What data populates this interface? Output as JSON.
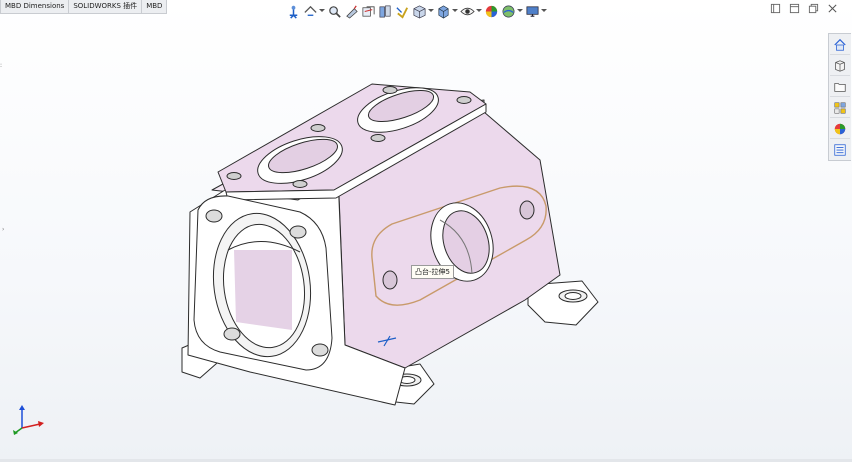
{
  "tabs": [
    {
      "label": "MBD Dimensions"
    },
    {
      "label": "SOLIDWORKS 插件"
    },
    {
      "label": "MBD"
    }
  ],
  "heads_up_toolbar": [
    {
      "icon": "zoom-to-fit-icon",
      "dropdown": false
    },
    {
      "icon": "zoom-to-area-icon",
      "dropdown": true
    },
    {
      "icon": "previous-view-icon",
      "dropdown": false
    },
    {
      "icon": "section-view-icon",
      "dropdown": false
    },
    {
      "icon": "dynamic-annotation-views-icon",
      "dropdown": false
    },
    {
      "icon": "view-orientation-icon",
      "dropdown": true
    },
    {
      "icon": "display-style-icon",
      "dropdown": true
    },
    {
      "icon": "hide-show-items-icon",
      "dropdown": true
    },
    {
      "icon": "edit-appearance-icon",
      "dropdown": false
    },
    {
      "icon": "apply-scene-icon",
      "dropdown": true
    },
    {
      "icon": "view-settings-icon",
      "dropdown": true
    }
  ],
  "window_controls": [
    "tile-icon",
    "restore-icon",
    "minimize-icon",
    "close-icon"
  ],
  "task_pane": [
    {
      "icon": "home-icon"
    },
    {
      "icon": "design-library-icon"
    },
    {
      "icon": "file-explorer-icon"
    },
    {
      "icon": "view-palette-icon"
    },
    {
      "icon": "appearances-icon"
    },
    {
      "icon": "custom-properties-icon"
    }
  ],
  "tooltip": {
    "label": "凸台-拉伸5"
  },
  "colors": {
    "face_highlight": "#e9d6ea",
    "face_white": "#ffffff",
    "edge": "#2c2c2c",
    "accent_blue": "#1d5fc7",
    "triad_x": "#d22020",
    "triad_y": "#1f9a24",
    "triad_z": "#1d4fd8"
  }
}
